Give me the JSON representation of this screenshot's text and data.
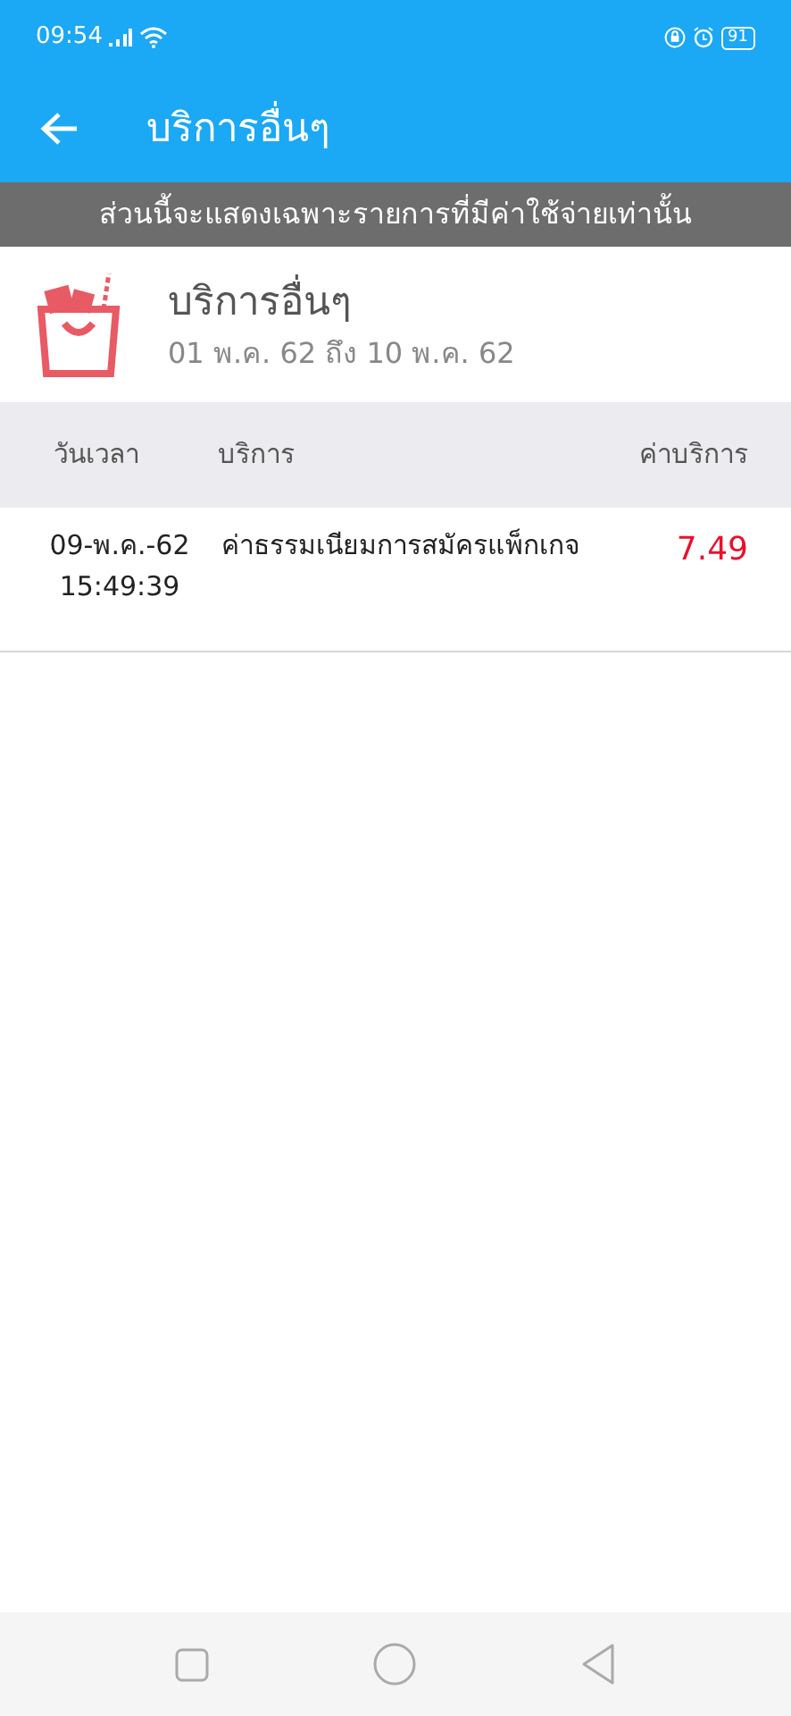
{
  "status_bar": {
    "time": "09:54",
    "battery": "91"
  },
  "app_bar": {
    "title": "บริการอื่นๆ"
  },
  "notice": "ส่วนนี้จะแสดงเฉพาะรายการที่มีค่าใช้จ่ายเท่านั้น",
  "summary": {
    "title": "บริการอื่นๆ",
    "period": "01 พ.ค. 62 ถึง 10 พ.ค. 62"
  },
  "table": {
    "columns": [
      "วันเวลา",
      "บริการ",
      "ค่าบริการ"
    ],
    "rows": [
      {
        "date": "09-พ.ค.-62",
        "time": "15:49:39",
        "service": "ค่าธรรมเนียมการสมัครแพ็กเกจ",
        "fee": "7.49"
      }
    ]
  }
}
